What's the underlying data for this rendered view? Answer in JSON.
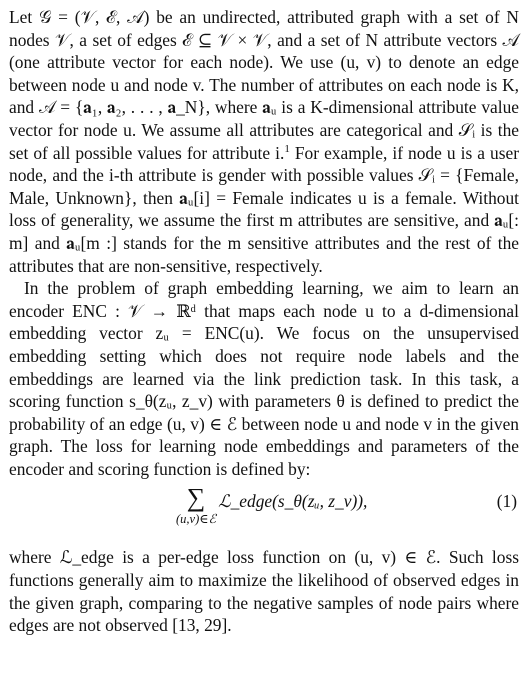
{
  "paragraph1": "Let 𝒢 = (𝒱, ℰ, 𝒜) be an undirected, attributed graph with a set of N nodes 𝒱, a set of edges ℰ ⊆ 𝒱 × 𝒱, and a set of N attribute vectors 𝒜 (one attribute vector for each node). We use (u, v) to denote an edge between node u and node v. The number of attributes on each node is K, and 𝒜 = {𝐚₁, 𝐚₂, . . . , 𝐚_N}, where 𝐚ᵤ is a K-dimensional attribute value vector for node u. We assume all attributes are categorical and 𝒮ᵢ is the set of all possible values for attribute i.",
  "footnote_marker": "1",
  "paragraph1_cont": " For example, if node u is a user node, and the i-th attribute is gender with possible values 𝒮ᵢ = {Female, Male, Unknown}, then 𝐚ᵤ[i] = Female indicates u is a female. Without loss of generality, we assume the first m attributes are sensitive, and 𝐚ᵤ[: m] and 𝐚ᵤ[m :] stands for the m sensitive attributes and the rest of the attributes that are non-sensitive, respectively.",
  "paragraph2": "In the problem of graph embedding learning, we aim to learn an encoder ENC : 𝒱 → ℝᵈ that maps each node u to a d-dimensional embedding vector zᵤ = ENC(u). We focus on the unsupervised embedding setting which does not require node labels and the embeddings are learned via the link prediction task. In this task, a scoring function s_θ(zᵤ, z_v) with parameters θ is defined to predict the probability of an edge (u, v) ∈ ℰ between node u and node v in the given graph. The loss for learning node embeddings and parameters of the encoder and scoring function is defined by:",
  "equation": {
    "sum_symbol": "∑",
    "subscript": "(u,v)∈ℰ",
    "expression": "ℒ_edge(s_θ(zᵤ, z_v)),",
    "number": "(1)"
  },
  "paragraph3": "where ℒ_edge is a per-edge loss function on (u, v) ∈ ℰ. Such loss functions generally aim to maximize the likelihood of observed edges in the given graph, comparing to the negative samples of node pairs where edges are not observed [13, 29]."
}
